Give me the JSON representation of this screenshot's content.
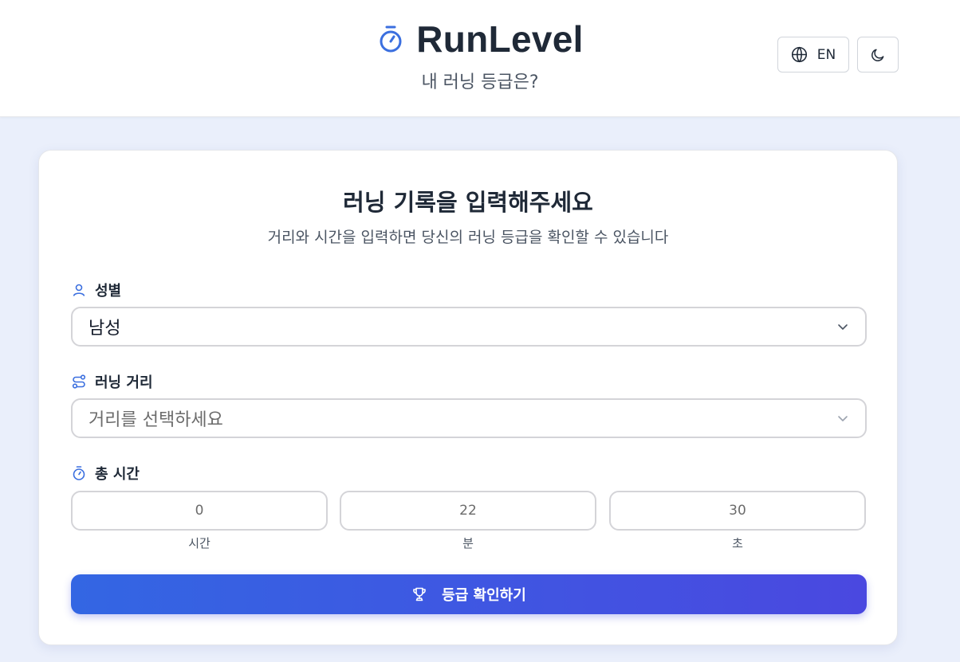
{
  "header": {
    "title": "RunLevel",
    "subtitle": "내 러닝 등급은?",
    "lang_label": "EN",
    "brand_color": "#3b6fdf"
  },
  "card": {
    "title": "러닝 기록을 입력해주세요",
    "description": "거리와 시간을 입력하면 당신의 러닝 등급을 확인할 수 있습니다"
  },
  "gender": {
    "label": "성별",
    "selected": "남성"
  },
  "distance": {
    "label": "러닝 거리",
    "placeholder": "거리를 선택하세요"
  },
  "time": {
    "label": "총 시간",
    "hours": {
      "value": "0",
      "unit": "시간"
    },
    "minutes": {
      "value": "22",
      "unit": "분"
    },
    "seconds": {
      "value": "30",
      "unit": "초"
    }
  },
  "submit": {
    "label": "등급 확인하기"
  },
  "icons": {
    "brand": "stopwatch-icon",
    "language": "globe-icon",
    "theme": "moon-icon",
    "gender": "user-icon",
    "distance": "route-icon",
    "time": "stopwatch-icon",
    "submit": "trophy-icon",
    "select": "chevron-down-icon"
  }
}
